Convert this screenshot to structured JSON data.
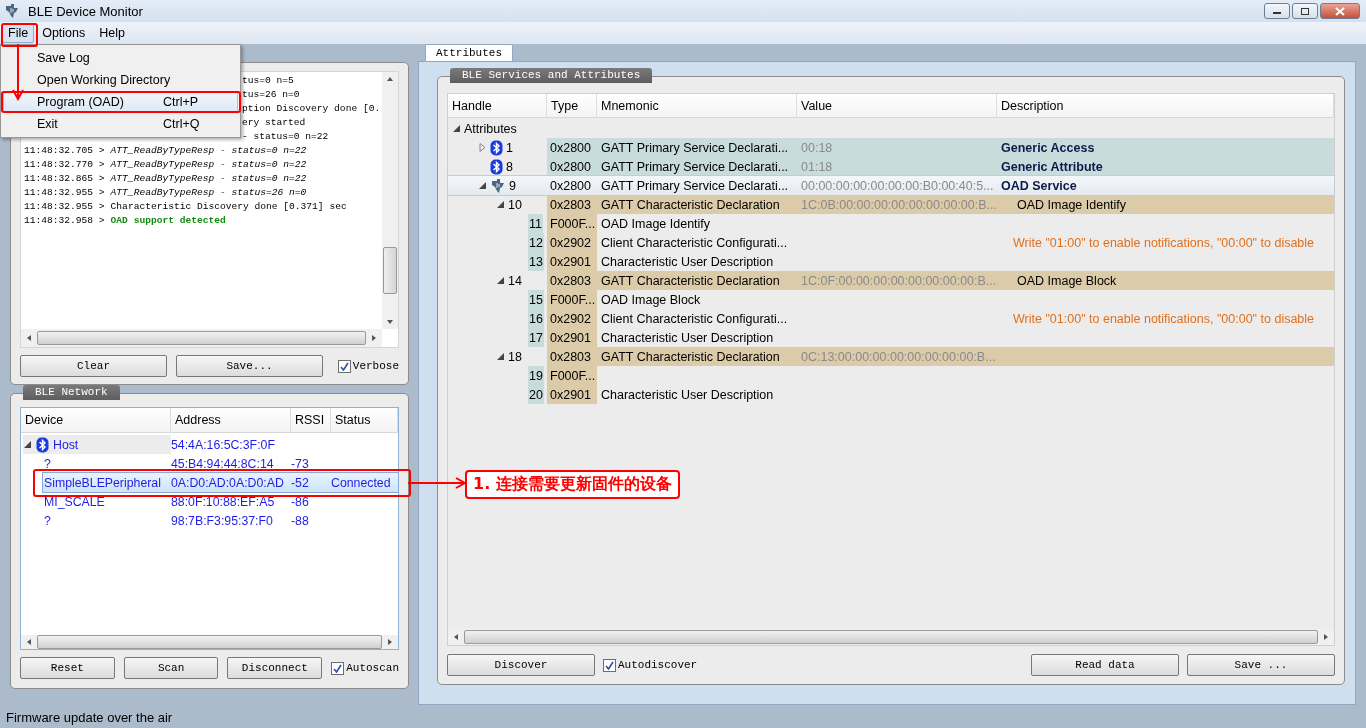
{
  "window": {
    "title": "BLE Device Monitor"
  },
  "menu_bar": [
    {
      "label": "File",
      "selected": true
    },
    {
      "label": "Options",
      "selected": false
    },
    {
      "label": "Help",
      "selected": false
    }
  ],
  "file_menu": [
    {
      "label": "Save Log",
      "selected": false
    },
    {
      "label": "Open Working Directory",
      "selected": false
    },
    {
      "label": "Program (OAD)",
      "shortcut": "Ctrl+P",
      "selected": true
    },
    {
      "label": "Exit",
      "shortcut": "Ctrl+Q",
      "selected": false
    }
  ],
  "log": {
    "lines": [
      {
        "kind": "partial",
        "text": "tus=0 n=5"
      },
      {
        "kind": "partial",
        "text": "tus=26 n=0"
      },
      {
        "kind": "partial",
        "text": "ption Discovery done [0."
      },
      {
        "kind": "partial",
        "text": "ery started"
      },
      {
        "kind": "partial",
        "text": "- status=0 n=22"
      },
      {
        "kind": "response",
        "time": "11:48:32.705 >",
        "text": "ATT_ReadByTypeResp - status=0 n=22"
      },
      {
        "kind": "response",
        "time": "11:48:32.770 >",
        "text": "ATT_ReadByTypeResp - status=0 n=22"
      },
      {
        "kind": "response",
        "time": "11:48:32.865 >",
        "text": "ATT_ReadByTypeResp - status=0 n=22"
      },
      {
        "kind": "response",
        "time": "11:48:32.955 >",
        "text": "ATT_ReadByTypeResp - status=26 n=0"
      },
      {
        "kind": "event",
        "time": "11:48:32.955 >",
        "text": "Characteristic Discovery done [0.371] sec"
      },
      {
        "kind": "success",
        "time": "11:48:32.958 >",
        "text": "OAD support detected"
      }
    ],
    "buttons": [
      "Clear",
      "Save..."
    ],
    "verbose": {
      "label": "Verbose",
      "checked": true
    }
  },
  "network": {
    "title": "BLE Network",
    "columns": [
      "Device",
      "Address",
      "RSSI",
      "Status"
    ],
    "rows": [
      {
        "device": "Host",
        "address": "54:4A:16:5C:3F:0F",
        "expanded": true,
        "children": [
          {
            "device": "?",
            "address": "45:B4:94:44:8C:14",
            "rssi": "-73",
            "selected": false
          },
          {
            "device": "SimpleBLEPeripheral",
            "address": "0A:D0:AD:0A:D0:AD",
            "rssi": "-52",
            "status": "Connected",
            "selected": true
          },
          {
            "device": "MI_SCALE",
            "address": "88:0F:10:88:EF:A5",
            "rssi": "-86",
            "selected": false
          },
          {
            "device": "?",
            "address": "98:7B:F3:95:37:F0",
            "rssi": "-88",
            "selected": false
          }
        ]
      }
    ],
    "buttons": [
      "Reset",
      "Scan",
      "Disconnect"
    ],
    "autoscan": {
      "label": "Autoscan",
      "checked": true
    }
  },
  "tabs": [
    {
      "label": "Attributes",
      "selected": true
    }
  ],
  "attributes": {
    "title": "BLE Services and Attributes",
    "columns": [
      "Handle",
      "Type",
      "Mnemonic",
      "Value",
      "Description"
    ],
    "tree": [
      {
        "kind": "root",
        "handle": "Attributes",
        "expanded": true,
        "children": [
          {
            "kind": "service",
            "handle": "1",
            "type": "0x2800",
            "mnemonic": "GATT Primary Service Declarati...",
            "value": "00:18",
            "description": "Generic Access",
            "expanded": false,
            "selected": false
          },
          {
            "kind": "service",
            "handle": "8",
            "type": "0x2800",
            "mnemonic": "GATT Primary Service Declarati...",
            "value": "01:18",
            "description": "Generic Attribute",
            "selected": false
          },
          {
            "kind": "custom_service",
            "handle": "9",
            "type": "0x2800",
            "mnemonic": "GATT Primary Service Declarati...",
            "value": "00:00:00:00:00:00:00:B0:00:40:5...",
            "description": "OAD Service",
            "expanded": true,
            "selected": true,
            "children": [
              {
                "kind": "characteristic",
                "handle": "10",
                "type": "0x2803",
                "mnemonic": "GATT Characteristic Declaration",
                "value": "1C:0B:00:00:00:00:00:00:00:00:B...",
                "description": "OAD Image Identify",
                "expanded": true,
                "selected": false,
                "children": [
                  {
                    "kind": "descriptor",
                    "handle": "11",
                    "type": "F000F...",
                    "mnemonic": "OAD Image Identify",
                    "selected": false
                  },
                  {
                    "kind": "descriptor",
                    "handle": "12",
                    "type": "0x2902",
                    "mnemonic": "Client Characteristic Configurati...",
                    "description": "Write \"01:00\" to enable notifications, \"00:00\" to disable",
                    "selected": false
                  },
                  {
                    "kind": "descriptor",
                    "handle": "13",
                    "type": "0x2901",
                    "mnemonic": "Characteristic User Description",
                    "selected": false
                  }
                ]
              },
              {
                "kind": "characteristic",
                "handle": "14",
                "type": "0x2803",
                "mnemonic": "GATT Characteristic Declaration",
                "value": "1C:0F:00:00:00:00:00:00:00:00:B...",
                "description": "OAD Image Block",
                "expanded": true,
                "selected": false,
                "children": [
                  {
                    "kind": "descriptor",
                    "handle": "15",
                    "type": "F000F...",
                    "mnemonic": "OAD Image Block",
                    "selected": false
                  },
                  {
                    "kind": "descriptor",
                    "handle": "16",
                    "type": "0x2902",
                    "mnemonic": "Client Characteristic Configurati...",
                    "description": "Write \"01:00\" to enable notifications, \"00:00\" to disable",
                    "selected": false
                  },
                  {
                    "kind": "descriptor",
                    "handle": "17",
                    "type": "0x2901",
                    "mnemonic": "Characteristic User Description",
                    "selected": false
                  }
                ]
              },
              {
                "kind": "characteristic",
                "handle": "18",
                "type": "0x2803",
                "mnemonic": "GATT Characteristic Declaration",
                "value": "0C:13:00:00:00:00:00:00:00:00:B...",
                "expanded": true,
                "selected": false,
                "children": [
                  {
                    "kind": "descriptor",
                    "handle": "19",
                    "type": "F000F...",
                    "selected": false
                  },
                  {
                    "kind": "descriptor",
                    "handle": "20",
                    "type": "0x2901",
                    "mnemonic": "Characteristic User Description",
                    "selected": false
                  }
                ]
              }
            ]
          }
        ]
      }
    ],
    "buttons_left": [
      "Discover"
    ],
    "autodiscover": {
      "label": "Autodiscover",
      "checked": true
    },
    "buttons_right": [
      "Read data",
      "Save ..."
    ]
  },
  "annotation": {
    "callout": "1. 连接需要更新固件的设备"
  },
  "status_bar": {
    "text": "Firmware update over the air"
  }
}
